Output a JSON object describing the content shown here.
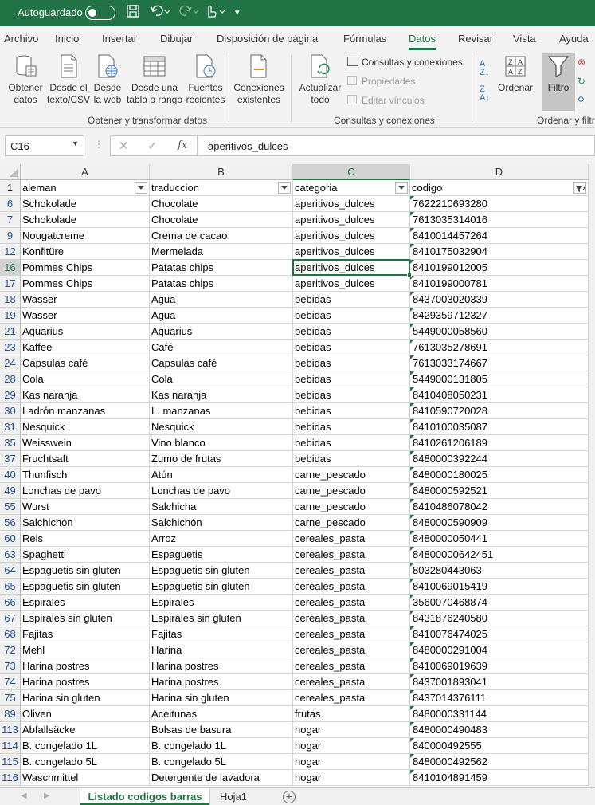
{
  "titlebar": {
    "autosave_label": "Autoguardado",
    "autosave_state": "off",
    "icons": [
      "save-icon",
      "undo-icon",
      "redo-icon",
      "touch-mode-icon",
      "customize-toolbar-icon"
    ]
  },
  "menu": {
    "tabs": [
      "Archivo",
      "Inicio",
      "Insertar",
      "Dibujar",
      "Disposición de página",
      "Fórmulas",
      "Datos",
      "Revisar",
      "Vista",
      "Ayuda"
    ],
    "active": "Datos"
  },
  "ribbon": {
    "get_data_label": "Obtener datos",
    "from_text_label": "Desde el texto/CSV",
    "from_web_label": "Desde la web",
    "from_table_label": "Desde una tabla o rango",
    "recent_sources_label": "Fuentes recientes",
    "existing_connections_label": "Conexiones existentes",
    "group_get_transform": "Obtener y transformar datos",
    "refresh_all_label": "Actualizar todo",
    "queries_connections_label": "Consultas y conexiones",
    "properties_label": "Propiedades",
    "edit_links_label": "Editar vínculos",
    "group_queries": "Consultas y conexiones",
    "sort_label": "Ordenar",
    "filter_label": "Filtro",
    "group_sort_filter": "Ordenar y filtrar"
  },
  "formula_bar": {
    "name_box": "C16",
    "fx_label": "fx",
    "value": "aperitivos_dulces"
  },
  "grid": {
    "columns": [
      "A",
      "B",
      "C",
      "D"
    ],
    "selected_column": "C",
    "selected_row": "16",
    "header_row": {
      "row": "1",
      "cells": [
        "aleman",
        "traduccion",
        "categoria",
        "codigo"
      ]
    },
    "rows": [
      {
        "row": "6",
        "cells": [
          "Schokolade",
          "Chocolate",
          "aperitivos_dulces",
          "7622210693280"
        ]
      },
      {
        "row": "7",
        "cells": [
          "Schokolade",
          "Chocolate",
          "aperitivos_dulces",
          "7613035314016"
        ]
      },
      {
        "row": "9",
        "cells": [
          "Nougatcreme",
          "Crema de cacao",
          "aperitivos_dulces",
          "8410014457264"
        ]
      },
      {
        "row": "12",
        "cells": [
          "Konfitüre",
          "Mermelada",
          "aperitivos_dulces",
          "8410175032904"
        ]
      },
      {
        "row": "16",
        "cells": [
          "Pommes Chips",
          "Patatas chips",
          "aperitivos_dulces",
          "8410199012005"
        ]
      },
      {
        "row": "17",
        "cells": [
          "Pommes Chips",
          "Patatas chips",
          "aperitivos_dulces",
          "8410199000781"
        ]
      },
      {
        "row": "18",
        "cells": [
          "Wasser",
          "Agua",
          "bebidas",
          "8437003020339"
        ]
      },
      {
        "row": "19",
        "cells": [
          "Wasser",
          "Agua",
          "bebidas",
          "8429359712327"
        ]
      },
      {
        "row": "21",
        "cells": [
          "Aquarius",
          "Aquarius",
          "bebidas",
          "5449000058560"
        ]
      },
      {
        "row": "23",
        "cells": [
          "Kaffee",
          "Café",
          "bebidas",
          "7613035278691"
        ]
      },
      {
        "row": "24",
        "cells": [
          "Capsulas café",
          "Capsulas café",
          "bebidas",
          "7613033174667"
        ]
      },
      {
        "row": "28",
        "cells": [
          "Cola",
          "Cola",
          "bebidas",
          "5449000131805"
        ]
      },
      {
        "row": "29",
        "cells": [
          "Kas naranja",
          "Kas naranja",
          "bebidas",
          "8410408050231"
        ]
      },
      {
        "row": "30",
        "cells": [
          "Ladrón manzanas",
          "L. manzanas",
          "bebidas",
          "8410590720028"
        ]
      },
      {
        "row": "31",
        "cells": [
          "Nesquick",
          "Nesquick",
          "bebidas",
          "8410100035087"
        ]
      },
      {
        "row": "35",
        "cells": [
          "Weisswein",
          "Vino blanco",
          "bebidas",
          "8410261206189"
        ]
      },
      {
        "row": "37",
        "cells": [
          "Fruchtsaft",
          "Zumo de frutas",
          "bebidas",
          "8480000392244"
        ]
      },
      {
        "row": "40",
        "cells": [
          "Thunfisch",
          "Atún",
          "carne_pescado",
          "8480000180025"
        ]
      },
      {
        "row": "49",
        "cells": [
          "Lonchas de pavo",
          "Lonchas de pavo",
          "carne_pescado",
          "8480000592521"
        ]
      },
      {
        "row": "55",
        "cells": [
          "Wurst",
          "Salchicha",
          "carne_pescado",
          "8410486078042"
        ]
      },
      {
        "row": "56",
        "cells": [
          "Salchichón",
          "Salchichón",
          "carne_pescado",
          "8480000590909"
        ]
      },
      {
        "row": "60",
        "cells": [
          "Reis",
          "Arroz",
          "cereales_pasta",
          "8480000050441"
        ]
      },
      {
        "row": "63",
        "cells": [
          "Spaghetti",
          "Espaguetis",
          "cereales_pasta",
          "84800000642451"
        ]
      },
      {
        "row": "64",
        "cells": [
          "Espaguetis sin gluten",
          "Espaguetis sin gluten",
          "cereales_pasta",
          "803280443063"
        ]
      },
      {
        "row": "65",
        "cells": [
          "Espaguetis sin gluten",
          "Espaguetis sin gluten",
          "cereales_pasta",
          "8410069015419"
        ]
      },
      {
        "row": "66",
        "cells": [
          "Espirales",
          "Espirales",
          "cereales_pasta",
          "3560070468874"
        ]
      },
      {
        "row": "67",
        "cells": [
          "Espirales sin gluten",
          "Espirales sin gluten",
          "cereales_pasta",
          "8431876240580"
        ]
      },
      {
        "row": "68",
        "cells": [
          "Fajitas",
          "Fajitas",
          "cereales_pasta",
          "8410076474025"
        ]
      },
      {
        "row": "72",
        "cells": [
          "Mehl",
          "Harina",
          "cereales_pasta",
          "8480000291004"
        ]
      },
      {
        "row": "73",
        "cells": [
          "Harina postres",
          "Harina postres",
          "cereales_pasta",
          "8410069019639"
        ]
      },
      {
        "row": "74",
        "cells": [
          "Harina postres",
          "Harina postres",
          "cereales_pasta",
          "8437001893041"
        ]
      },
      {
        "row": "75",
        "cells": [
          "Harina sin gluten",
          "Harina sin gluten",
          "cereales_pasta",
          "8437014376111"
        ]
      },
      {
        "row": "89",
        "cells": [
          "Oliven",
          "Aceitunas",
          "frutas",
          "8480000331144"
        ]
      },
      {
        "row": "113",
        "cells": [
          "Abfallsäcke",
          "Bolsas de basura",
          "hogar",
          "8480000490483"
        ]
      },
      {
        "row": "114",
        "cells": [
          "B. congelado 1L",
          "B. congelado 1L",
          "hogar",
          "840000492555"
        ]
      },
      {
        "row": "115",
        "cells": [
          "B. congelado 5L",
          "B. congelado 5L",
          "hogar",
          "8480000492562"
        ]
      },
      {
        "row": "116",
        "cells": [
          "Waschmittel",
          "Detergente de lavadora",
          "hogar",
          "8410104891459"
        ]
      }
    ]
  },
  "sheets": {
    "tabs": [
      "Listado codigos barras",
      "Hoja1"
    ],
    "active": "Listado codigos barras",
    "add_label": "+"
  },
  "colors": {
    "excel_green": "#217346",
    "row_number_blue": "#1f4e9d",
    "ribbon_bg": "#f3f3f3"
  }
}
